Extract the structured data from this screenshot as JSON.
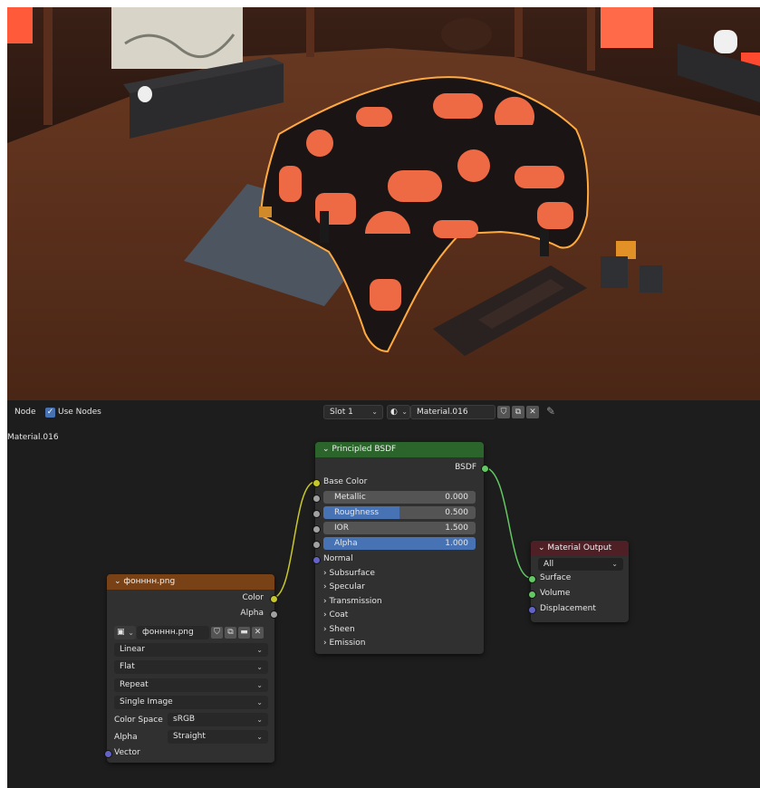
{
  "header": {
    "node_menu": "Node",
    "use_nodes_label": "Use Nodes",
    "use_nodes_checked": true,
    "slot": "Slot 1",
    "material_name": "Material.016"
  },
  "editor_label": "Material.016",
  "image_node": {
    "title": "фонннн.png",
    "outputs": [
      "Color",
      "Alpha"
    ],
    "image_name": "фонннн.png",
    "interpolation": "Linear",
    "projection": "Flat",
    "extension": "Repeat",
    "source": "Single Image",
    "color_space_label": "Color Space",
    "color_space": "sRGB",
    "alpha_label": "Alpha",
    "alpha_mode": "Straight",
    "vector_label": "Vector"
  },
  "bsdf_node": {
    "title": "Principled BSDF",
    "output": "BSDF",
    "base_color": "Base Color",
    "params": [
      {
        "label": "Metallic",
        "value": "0.000",
        "fraction": 0.0
      },
      {
        "label": "Roughness",
        "value": "0.500",
        "fraction": 0.5
      },
      {
        "label": "IOR",
        "value": "1.500",
        "fraction": 0.0
      },
      {
        "label": "Alpha",
        "value": "1.000",
        "fraction": 1.0
      }
    ],
    "normal": "Normal",
    "panels": [
      "Subsurface",
      "Specular",
      "Transmission",
      "Coat",
      "Sheen",
      "Emission"
    ]
  },
  "output_node": {
    "title": "Material Output",
    "target": "All",
    "inputs": [
      "Surface",
      "Volume",
      "Displacement"
    ]
  },
  "colors": {
    "editor_bg": "#1d1d1d",
    "node_bg": "#303030",
    "shader_header": "#2b652b",
    "texture_header": "#794216",
    "output_header": "#4f1f26",
    "color_socket": "#c7c729",
    "float_socket": "#a1a1a1",
    "shader_socket": "#63c763",
    "vector_socket": "#6363c7",
    "slider_fill": "#4772b3",
    "selection_outline": "#ffaa40"
  }
}
